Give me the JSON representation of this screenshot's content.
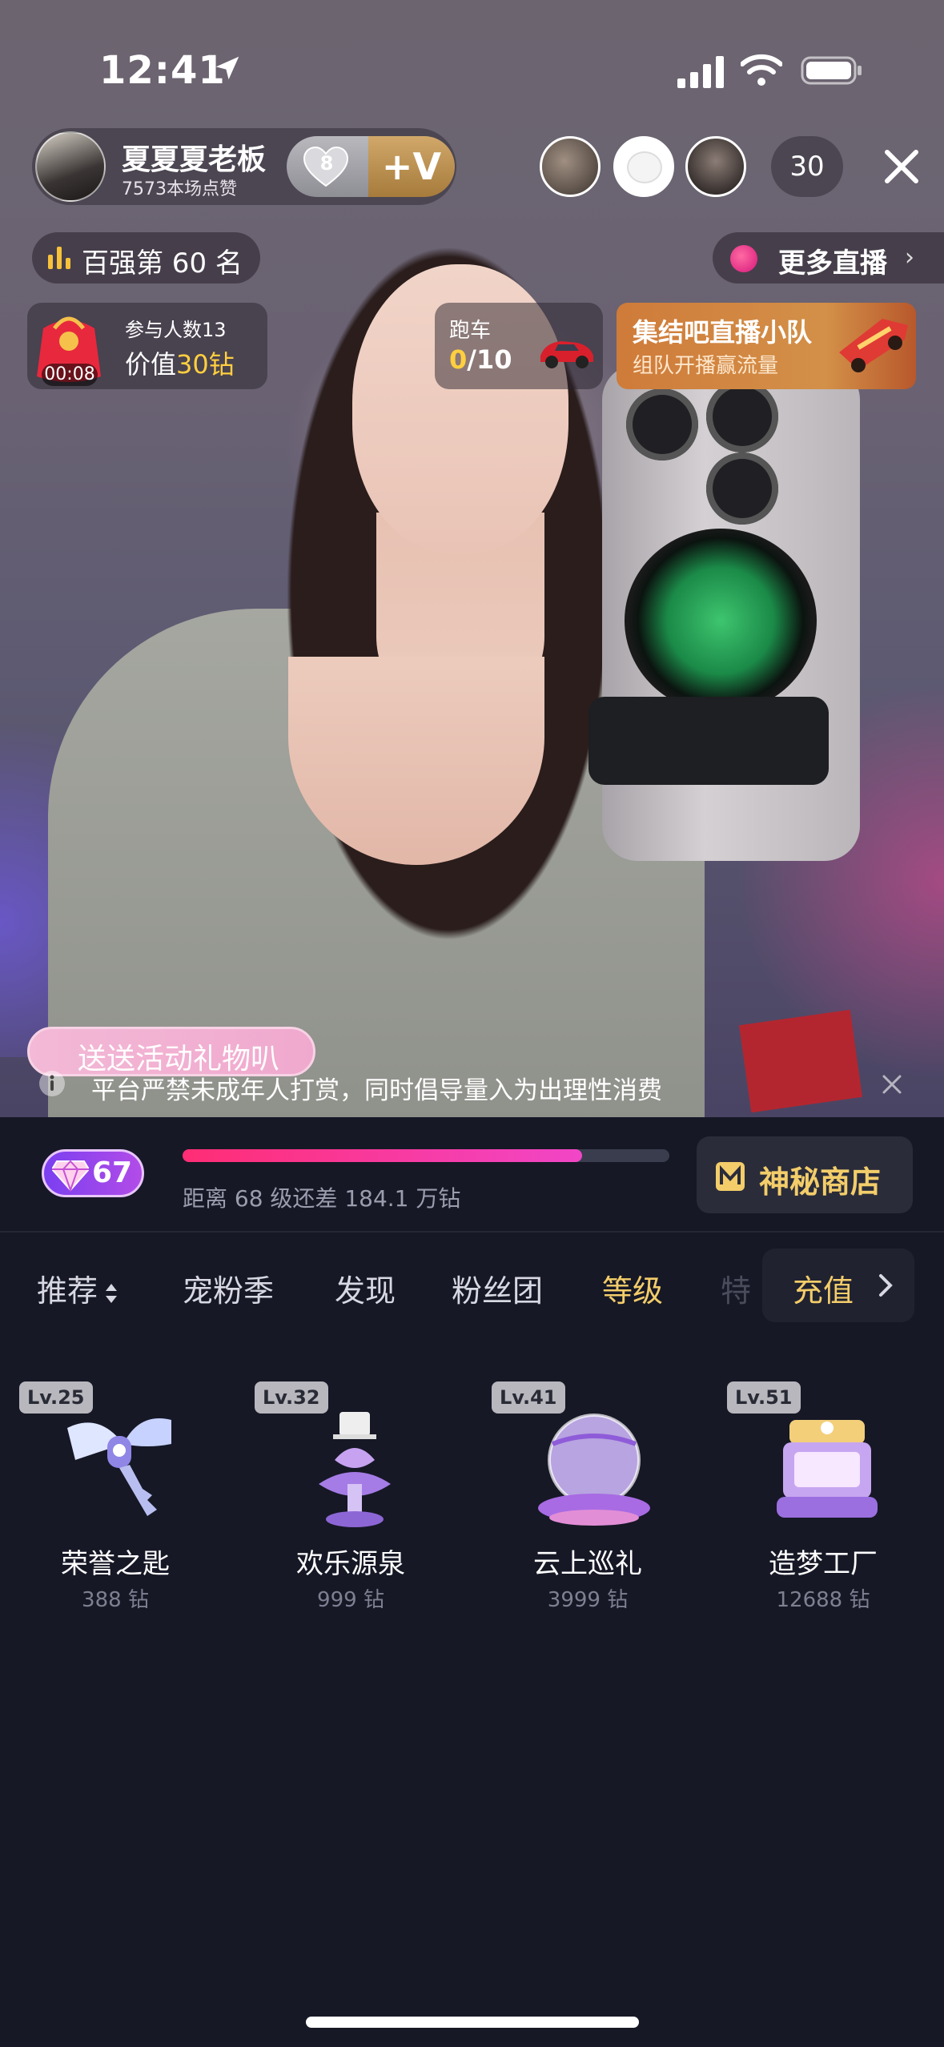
{
  "status_bar": {
    "time": "12:41"
  },
  "streamer": {
    "name": "夏夏夏老板",
    "likes": "7573本场点赞",
    "fan_level": "8",
    "follow_label": "+V"
  },
  "viewers": {
    "count": "30"
  },
  "rank": {
    "label": "百强第 60 名"
  },
  "more_live": {
    "label": "更多直播",
    "chevron": "›"
  },
  "red_packet": {
    "timer": "00:08",
    "participants": "参与人数13",
    "value_prefix": "价值",
    "value_amount": "30钻"
  },
  "race_car": {
    "title": "跑车",
    "current": "0",
    "total": "/10"
  },
  "squad_banner": {
    "title": "集结吧直播小队",
    "subtitle": "组队开播赢流量"
  },
  "gift_bubble": {
    "text": "送送活动礼物叭"
  },
  "notice": {
    "text": "平台严禁未成年人打赏，同时倡导量入为出理性消费"
  },
  "user_level": {
    "level": "67",
    "progress_fraction": 0.82,
    "progress_text": "距离 68 级还差 184.1 万钻"
  },
  "shop": {
    "label": "神秘商店"
  },
  "tabs": [
    {
      "label": "推荐"
    },
    {
      "label": "宠粉季"
    },
    {
      "label": "发现"
    },
    {
      "label": "粉丝团"
    },
    {
      "label": "等级"
    },
    {
      "label": "特"
    }
  ],
  "recharge": {
    "label": "充值"
  },
  "gifts": [
    {
      "level": "Lv.25",
      "name": "荣誉之匙",
      "price": "388 钻"
    },
    {
      "level": "Lv.32",
      "name": "欢乐源泉",
      "price": "999 钻"
    },
    {
      "level": "Lv.41",
      "name": "云上巡礼",
      "price": "3999 钻"
    },
    {
      "level": "Lv.51",
      "name": "造梦工厂",
      "price": "12688 钻"
    }
  ]
}
